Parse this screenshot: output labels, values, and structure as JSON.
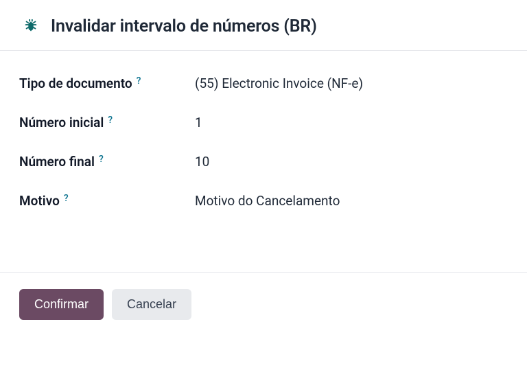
{
  "header": {
    "title": "Invalidar intervalo de números (BR)"
  },
  "form": {
    "document_type": {
      "label": "Tipo de documento",
      "value": "(55) Electronic Invoice (NF-e)"
    },
    "start_number": {
      "label": "Número inicial",
      "value": "1"
    },
    "end_number": {
      "label": "Número final",
      "value": "10"
    },
    "reason": {
      "label": "Motivo",
      "value": "Motivo do Cancelamento"
    },
    "help_glyph": "?"
  },
  "footer": {
    "confirm_label": "Confirmar",
    "cancel_label": "Cancelar"
  }
}
